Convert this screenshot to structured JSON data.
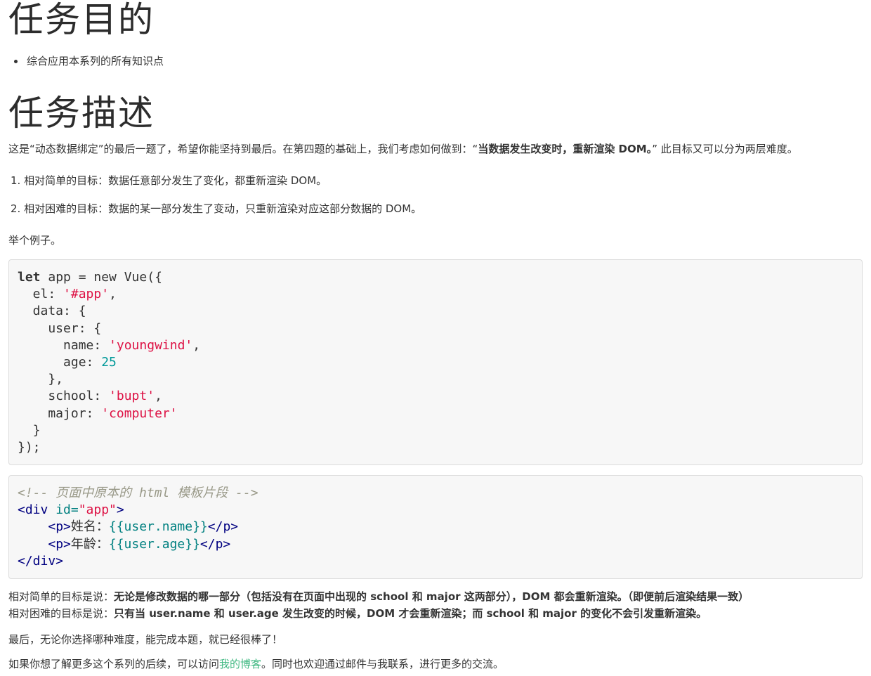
{
  "section1": {
    "title": "任务目的",
    "bullets": [
      "综合应用本系列的所有知识点"
    ]
  },
  "section2": {
    "title": "任务描述",
    "intro_prefix": "这是“动态数据绑定”的最后一题了，希望你能坚持到最后。在第四题的基础上，我们考虑如何做到：“",
    "intro_bold": "当数据发生改变时，重新渲染 DOM。",
    "intro_suffix": "” 此目标又可以分为两层难度。",
    "item1": "1. 相对简单的目标：数据任意部分发生了变化，都重新渲染 DOM。",
    "item2": "2. 相对困难的目标：数据的某一部分发生了变动，只重新渲染对应这部分数据的 DOM。",
    "example_label": "举个例子。"
  },
  "code_js": {
    "l1_kw": "let",
    "l1_rest": " app = new Vue({",
    "l2_key": "  el: ",
    "l2_val": "'#app'",
    "l2_end": ",",
    "l3": "  data: {",
    "l4": "    user: {",
    "l5_key": "      name: ",
    "l5_val": "'youngwind'",
    "l5_end": ",",
    "l6_key": "      age: ",
    "l6_val": "25",
    "l7": "    },",
    "l8_key": "    school: ",
    "l8_val": "'bupt'",
    "l8_end": ",",
    "l9_key": "    major: ",
    "l9_val": "'computer'",
    "l10": "  }",
    "l11": "});"
  },
  "code_html": {
    "comment": "<!-- 页面中原本的 html 模板片段 -->",
    "div_open_a": "<div ",
    "div_attr": "id=",
    "div_attr_val": "\"app\"",
    "div_open_b": ">",
    "p1_indent": "    ",
    "p1_open": "<p>",
    "p1_text": "姓名：",
    "p1_tpl": "{{user.name}}",
    "p1_close": "</p>",
    "p2_indent": "    ",
    "p2_open": "<p>",
    "p2_text": "年龄：",
    "p2_tpl": "{{user.age}}",
    "p2_close": "</p>",
    "div_close": "</div>"
  },
  "explain": {
    "simple_prefix": "相对简单的目标是说：",
    "simple_bold": "无论是修改数据的哪一部分（包括没有在页面中出现的 school 和 major 这两部分），DOM 都会重新渲染。（即便前后渲染结果一致）",
    "hard_prefix": "相对困难的目标是说：",
    "hard_bold": "只有当 user.name 和 user.age 发生改变的时候，DOM 才会重新渲染；而 school 和 major 的变化不会引发重新渲染。",
    "final": "最后，无论你选择哪种难度，能完成本题，就已经很棒了！",
    "more_prefix": "如果你想了解更多这个系列的后续，可以访问",
    "more_link": "我的博客",
    "more_suffix": "。同时也欢迎通过邮件与我联系，进行更多的交流。"
  },
  "colors": {
    "link": "#42b983",
    "string": "#dd1144",
    "number": "#009999",
    "comment": "#999988",
    "tag": "#000080",
    "attr": "#008080"
  }
}
